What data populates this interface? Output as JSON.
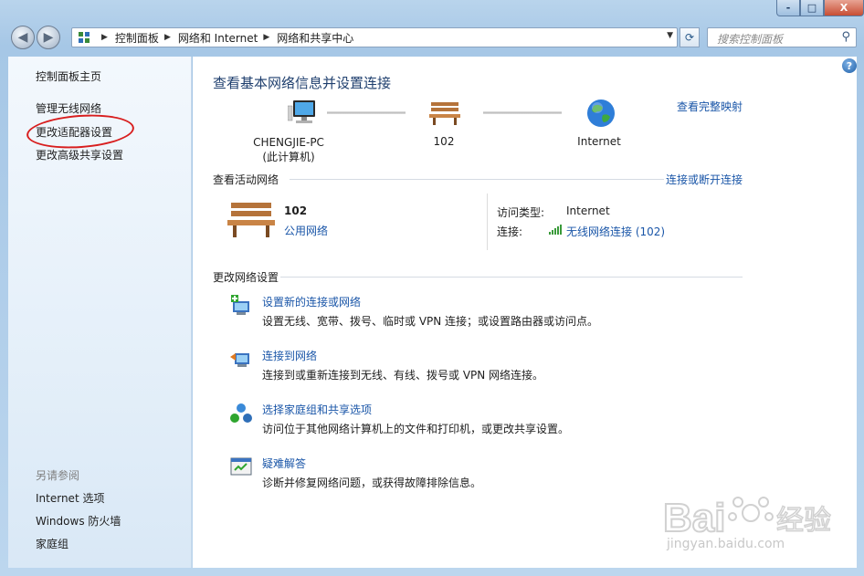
{
  "window": {
    "caption_buttons": {
      "minimize": "-",
      "maximize": "□",
      "close": "X"
    }
  },
  "address_bar": {
    "crumbs": [
      "控制面板",
      "网络和 Internet",
      "网络和共享中心"
    ],
    "search_placeholder": "搜索控制面板"
  },
  "sidebar": {
    "home": "控制面板主页",
    "wireless": "管理无线网络",
    "adapter": "更改适配器设置",
    "advanced_sharing": "更改高级共享设置",
    "see_also_title": "另请参阅",
    "see_also": [
      "Internet 选项",
      "Windows 防火墙",
      "家庭组"
    ]
  },
  "main": {
    "title": "查看基本网络信息并设置连接",
    "full_map_link": "查看完整映射",
    "nodes": {
      "pc_name": "CHENGJIE-PC",
      "pc_sub": "(此计算机)",
      "network": "102",
      "internet": "Internet"
    },
    "active_section_title": "查看活动网络",
    "connect_disconnect_link": "连接或断开连接",
    "active_network": {
      "name": "102",
      "type": "公用网络",
      "access_label": "访问类型:",
      "access_value": "Internet",
      "connection_label": "连接:",
      "connection_value": "无线网络连接 (102)"
    },
    "change_section_title": "更改网络设置",
    "tasks": [
      {
        "link": "设置新的连接或网络",
        "desc": "设置无线、宽带、拨号、临时或 VPN 连接；或设置路由器或访问点。"
      },
      {
        "link": "连接到网络",
        "desc": "连接到或重新连接到无线、有线、拨号或 VPN 网络连接。"
      },
      {
        "link": "选择家庭组和共享选项",
        "desc": "访问位于其他网络计算机上的文件和打印机，或更改共享设置。"
      },
      {
        "link": "疑难解答",
        "desc": "诊断并修复网络问题，或获得故障排除信息。"
      }
    ]
  },
  "watermark": {
    "text": "Bai 经验",
    "url": "jingyan.baidu.com"
  },
  "colors": {
    "link": "#1a56a8",
    "title": "#1f3f6e",
    "highlight": "#d81e1e"
  }
}
